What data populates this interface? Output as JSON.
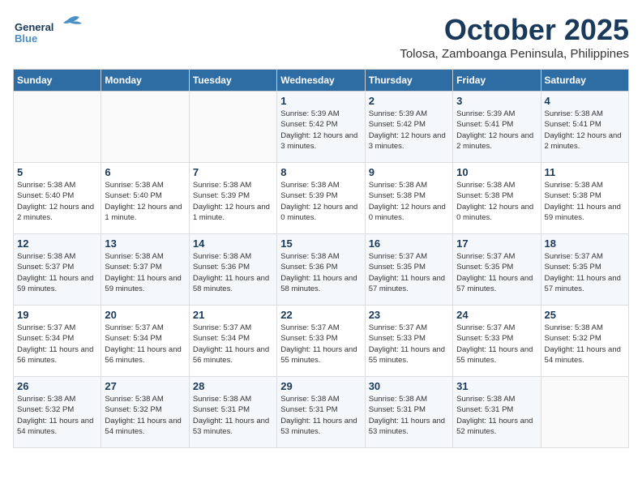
{
  "header": {
    "logo_general": "General",
    "logo_blue": "Blue",
    "month": "October 2025",
    "location": "Tolosa, Zamboanga Peninsula, Philippines"
  },
  "weekdays": [
    "Sunday",
    "Monday",
    "Tuesday",
    "Wednesday",
    "Thursday",
    "Friday",
    "Saturday"
  ],
  "weeks": [
    [
      {
        "day": "",
        "info": ""
      },
      {
        "day": "",
        "info": ""
      },
      {
        "day": "",
        "info": ""
      },
      {
        "day": "1",
        "info": "Sunrise: 5:39 AM\nSunset: 5:42 PM\nDaylight: 12 hours and 3 minutes."
      },
      {
        "day": "2",
        "info": "Sunrise: 5:39 AM\nSunset: 5:42 PM\nDaylight: 12 hours and 3 minutes."
      },
      {
        "day": "3",
        "info": "Sunrise: 5:39 AM\nSunset: 5:41 PM\nDaylight: 12 hours and 2 minutes."
      },
      {
        "day": "4",
        "info": "Sunrise: 5:38 AM\nSunset: 5:41 PM\nDaylight: 12 hours and 2 minutes."
      }
    ],
    [
      {
        "day": "5",
        "info": "Sunrise: 5:38 AM\nSunset: 5:40 PM\nDaylight: 12 hours and 2 minutes."
      },
      {
        "day": "6",
        "info": "Sunrise: 5:38 AM\nSunset: 5:40 PM\nDaylight: 12 hours and 1 minute."
      },
      {
        "day": "7",
        "info": "Sunrise: 5:38 AM\nSunset: 5:39 PM\nDaylight: 12 hours and 1 minute."
      },
      {
        "day": "8",
        "info": "Sunrise: 5:38 AM\nSunset: 5:39 PM\nDaylight: 12 hours and 0 minutes."
      },
      {
        "day": "9",
        "info": "Sunrise: 5:38 AM\nSunset: 5:38 PM\nDaylight: 12 hours and 0 minutes."
      },
      {
        "day": "10",
        "info": "Sunrise: 5:38 AM\nSunset: 5:38 PM\nDaylight: 12 hours and 0 minutes."
      },
      {
        "day": "11",
        "info": "Sunrise: 5:38 AM\nSunset: 5:38 PM\nDaylight: 11 hours and 59 minutes."
      }
    ],
    [
      {
        "day": "12",
        "info": "Sunrise: 5:38 AM\nSunset: 5:37 PM\nDaylight: 11 hours and 59 minutes."
      },
      {
        "day": "13",
        "info": "Sunrise: 5:38 AM\nSunset: 5:37 PM\nDaylight: 11 hours and 59 minutes."
      },
      {
        "day": "14",
        "info": "Sunrise: 5:38 AM\nSunset: 5:36 PM\nDaylight: 11 hours and 58 minutes."
      },
      {
        "day": "15",
        "info": "Sunrise: 5:38 AM\nSunset: 5:36 PM\nDaylight: 11 hours and 58 minutes."
      },
      {
        "day": "16",
        "info": "Sunrise: 5:37 AM\nSunset: 5:35 PM\nDaylight: 11 hours and 57 minutes."
      },
      {
        "day": "17",
        "info": "Sunrise: 5:37 AM\nSunset: 5:35 PM\nDaylight: 11 hours and 57 minutes."
      },
      {
        "day": "18",
        "info": "Sunrise: 5:37 AM\nSunset: 5:35 PM\nDaylight: 11 hours and 57 minutes."
      }
    ],
    [
      {
        "day": "19",
        "info": "Sunrise: 5:37 AM\nSunset: 5:34 PM\nDaylight: 11 hours and 56 minutes."
      },
      {
        "day": "20",
        "info": "Sunrise: 5:37 AM\nSunset: 5:34 PM\nDaylight: 11 hours and 56 minutes."
      },
      {
        "day": "21",
        "info": "Sunrise: 5:37 AM\nSunset: 5:34 PM\nDaylight: 11 hours and 56 minutes."
      },
      {
        "day": "22",
        "info": "Sunrise: 5:37 AM\nSunset: 5:33 PM\nDaylight: 11 hours and 55 minutes."
      },
      {
        "day": "23",
        "info": "Sunrise: 5:37 AM\nSunset: 5:33 PM\nDaylight: 11 hours and 55 minutes."
      },
      {
        "day": "24",
        "info": "Sunrise: 5:37 AM\nSunset: 5:33 PM\nDaylight: 11 hours and 55 minutes."
      },
      {
        "day": "25",
        "info": "Sunrise: 5:38 AM\nSunset: 5:32 PM\nDaylight: 11 hours and 54 minutes."
      }
    ],
    [
      {
        "day": "26",
        "info": "Sunrise: 5:38 AM\nSunset: 5:32 PM\nDaylight: 11 hours and 54 minutes."
      },
      {
        "day": "27",
        "info": "Sunrise: 5:38 AM\nSunset: 5:32 PM\nDaylight: 11 hours and 54 minutes."
      },
      {
        "day": "28",
        "info": "Sunrise: 5:38 AM\nSunset: 5:31 PM\nDaylight: 11 hours and 53 minutes."
      },
      {
        "day": "29",
        "info": "Sunrise: 5:38 AM\nSunset: 5:31 PM\nDaylight: 11 hours and 53 minutes."
      },
      {
        "day": "30",
        "info": "Sunrise: 5:38 AM\nSunset: 5:31 PM\nDaylight: 11 hours and 53 minutes."
      },
      {
        "day": "31",
        "info": "Sunrise: 5:38 AM\nSunset: 5:31 PM\nDaylight: 11 hours and 52 minutes."
      },
      {
        "day": "",
        "info": ""
      }
    ]
  ]
}
